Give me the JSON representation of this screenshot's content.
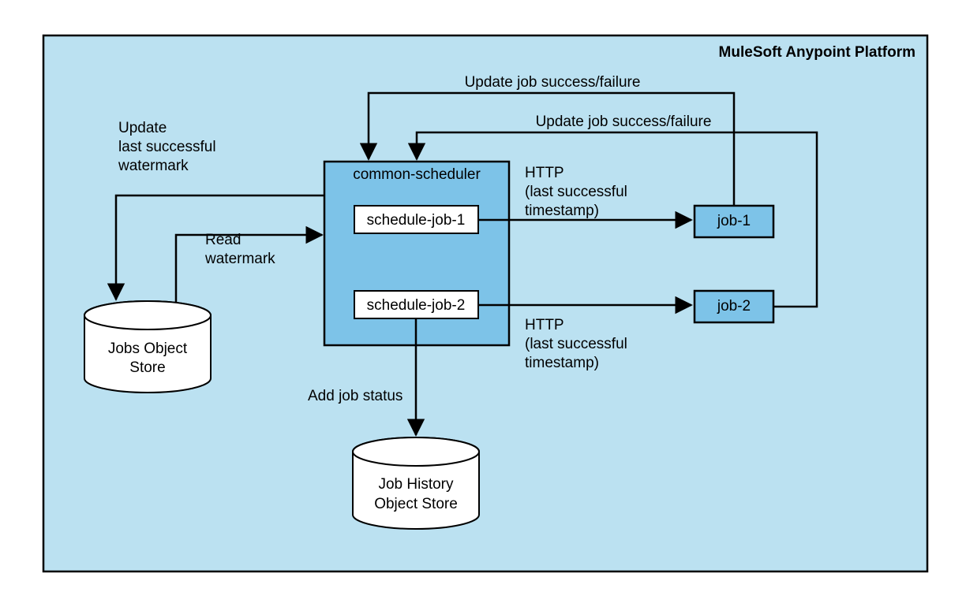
{
  "platform_title": "MuleSoft Anypoint Platform",
  "scheduler": {
    "title": "common-scheduler"
  },
  "jobs_inside": [
    "schedule-job-1",
    "schedule-job-2"
  ],
  "external_jobs": [
    "job-1",
    "job-2"
  ],
  "stores": {
    "jobs": {
      "line1": "Jobs Object",
      "line2": "Store"
    },
    "history": {
      "line1": "Job History",
      "line2": "Object Store"
    }
  },
  "labels": {
    "update_watermark_l1": "Update",
    "update_watermark_l2": "last successful",
    "update_watermark_l3": "watermark",
    "read_watermark_l1": "Read",
    "read_watermark_l2": "watermark",
    "add_job_status": "Add job status",
    "update_job_sf": "Update job success/failure",
    "http_l1": "HTTP",
    "http_l2": "(last successful",
    "http_l3": "timestamp)"
  }
}
